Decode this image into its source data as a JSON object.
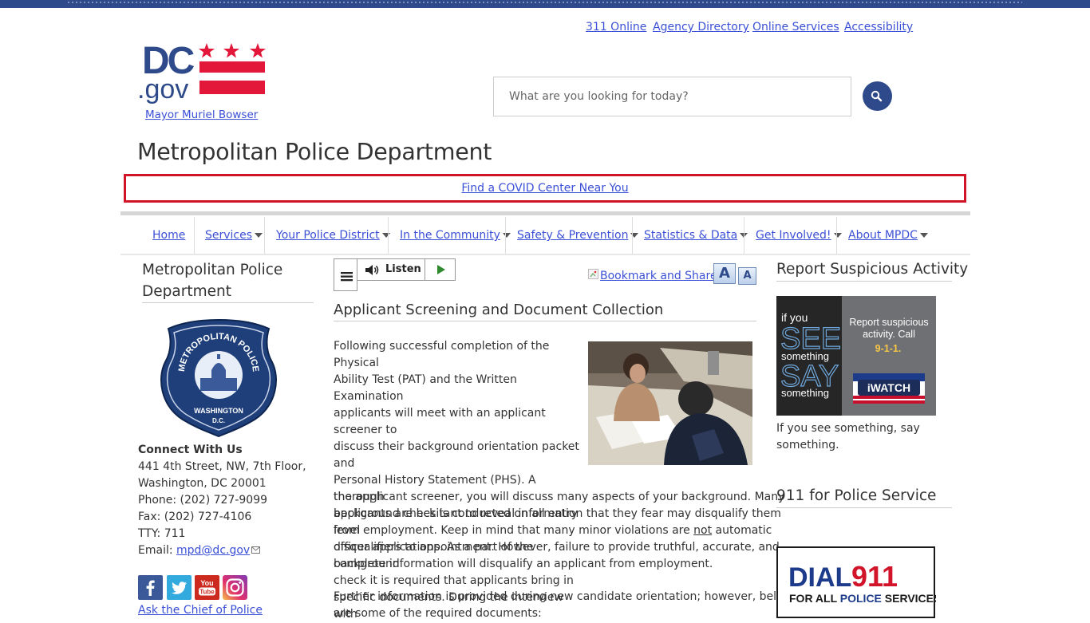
{
  "utility_links": [
    "311 Online",
    "Agency Directory",
    "Online Services",
    "Accessibility"
  ],
  "mayor_link": "Mayor Muriel Bowser",
  "search": {
    "placeholder": "What are you looking for today?"
  },
  "page_title": "Metropolitan Police Department",
  "covid_banner": "Find a COVID Center Near You",
  "nav": [
    {
      "label": "Home",
      "dropdown": false
    },
    {
      "label": "Services",
      "dropdown": true
    },
    {
      "label": "Your Police District",
      "dropdown": true
    },
    {
      "label": "In the Community",
      "dropdown": true
    },
    {
      "label": "Safety & Prevention",
      "dropdown": true
    },
    {
      "label": "Statistics & Data",
      "dropdown": true
    },
    {
      "label": "Get Involved!",
      "dropdown": true
    },
    {
      "label": "About MPDC",
      "dropdown": true
    }
  ],
  "sidebar": {
    "title": "Metropolitan Police Department",
    "badge_text": [
      "METROPOLITAN POLICE",
      "WASHINGTON",
      "D.C."
    ],
    "connect_heading": "Connect With Us",
    "address1": "441 4th Street, NW, 7th Floor,",
    "address2": "Washington, DC 20001",
    "phone": "Phone: (202) 727-9099",
    "fax": "Fax: (202) 727-4106",
    "tty": "TTY: 711",
    "email_label": "Email: ",
    "email": "mpd@dc.gov",
    "chief_link": "Ask the Chief of Police"
  },
  "toolbar": {
    "listen_label": "Listen",
    "bookmark_label": "Bookmark and Share",
    "font_large": "A",
    "font_small": "A"
  },
  "article": {
    "title": "Applicant Screening and Document Collection",
    "wrap_lines": [
      "Following successful completion of the Physical",
      "Ability Test (PAT) and the Written Examination",
      "applicants will meet with an applicant screener to",
      "discuss their background orientation packet and",
      "Personal History Statement (PHS).  A thorough",
      "background check is conducted on all entry level",
      "officer applications. As a part of the background",
      "check it is required that applicants bring in",
      "specific documents.  During the interview with"
    ],
    "full_line1": "the applicant screener, you will discuss many aspects of your background.  Many",
    "full_line2": "applicants are hesitant to reveal information that they fear may disqualify them",
    "full_line3_pre": "from employment. Keep in mind that many minor violations are ",
    "full_line3_u": "not",
    "full_line3_post": " automatic",
    "full_line4": "disqualifiers to appointment.  However, failure to provide truthful, accurate, and",
    "full_line5": "complete information will disqualify an applicant from employment.",
    "para2_line1": "Further information is provided during new candidate orientation; however, below",
    "para2_line2": "are some of the required documents:"
  },
  "right": {
    "suspicious_title": "Report Suspicious Activity",
    "iwatch_left": [
      "if you",
      "SEE",
      "something",
      "SAY",
      "something"
    ],
    "iwatch_right": "Report suspicious activity. Call",
    "iwatch_number": "9-1-1.",
    "iwatch_logo": "iWATCH",
    "caption1": "If you see something, say",
    "caption2": "something.",
    "police_title": "911 for Police Service",
    "dial_line1a": "DIAL",
    "dial_line1b": "911",
    "dial_line2a": "FOR ALL ",
    "dial_line2b": "POLICE",
    "dial_line2c": " SERVICES"
  },
  "colors": {
    "brand_blue": "#2e4a8a",
    "dc_red": "#e3173a",
    "link": "#3b50d6",
    "covid_border": "#d2142b"
  }
}
